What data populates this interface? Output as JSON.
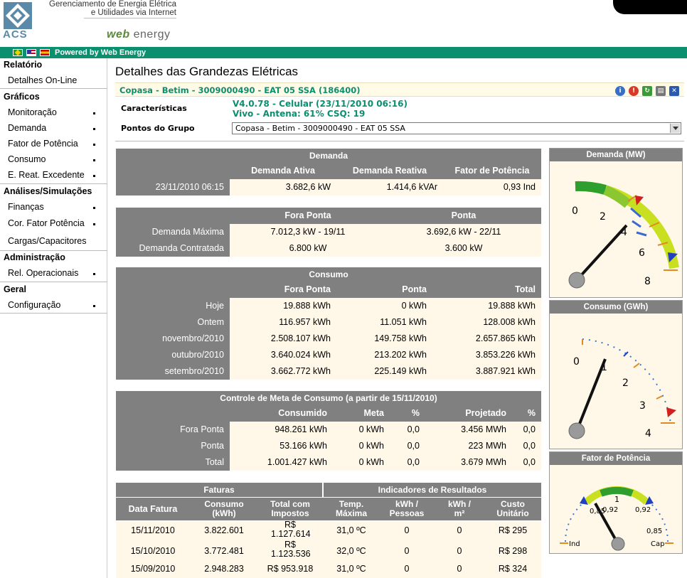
{
  "header": {
    "logo_text": "ACS",
    "company_line1": "Gerenciamento de Energia Elétrica",
    "company_line2": "e Utilidades via Internet",
    "brand_web": "web",
    "brand_energy": "energy",
    "powered_by": "Powered by Web Energy"
  },
  "sidebar": {
    "sections": [
      {
        "title": "Relatório",
        "items": [
          "Detalhes On-Line"
        ]
      },
      {
        "title": "Gráficos",
        "items": [
          "Monitoração",
          "Demanda",
          "Fator de Potência",
          "Consumo",
          "E. Reat. Excedente"
        ]
      },
      {
        "title": "Análises/Simulações",
        "items": [
          "Finanças",
          "Cor. Fator Potência",
          "Cargas/Capacitores"
        ]
      },
      {
        "title": "Administração",
        "items": [
          "Rel. Operacionais"
        ]
      },
      {
        "title": "Geral",
        "items": [
          "Configuração"
        ]
      }
    ]
  },
  "main": {
    "title": "Detalhes das Grandezas Elétricas",
    "subheader": "Copasa - Betim - 3009000490 - EAT 05 SSA (186400)",
    "caracteristicas_label": "Características",
    "caracteristicas_line1": "V4.0.78 - Celular (23/11/2010 06:16)",
    "caracteristicas_line2": "Vivo - Antena: 61% CSQ: 19",
    "pontos_label": "Pontos do Grupo",
    "pontos_value": "Copasa - Betim - 3009000490 - EAT 05 SSA"
  },
  "demanda": {
    "title": "Demanda",
    "cols": [
      "Demanda Ativa",
      "Demanda Reativa",
      "Fator de Potência"
    ],
    "row_label": "23/11/2010 06:15",
    "values": [
      "3.682,6 kW",
      "1.414,6 kVAr",
      "0,93 Ind"
    ]
  },
  "contrato": {
    "cols": [
      "Fora Ponta",
      "Ponta"
    ],
    "rows": [
      {
        "label": "Demanda Máxima",
        "values": [
          "7.012,3 kW - 19/11",
          "3.692,6 kW - 22/11"
        ]
      },
      {
        "label": "Demanda Contratada",
        "values": [
          "6.800 kW",
          "3.600 kW"
        ]
      }
    ]
  },
  "consumo": {
    "title": "Consumo",
    "cols": [
      "Fora Ponta",
      "Ponta",
      "Total"
    ],
    "rows": [
      {
        "label": "Hoje",
        "values": [
          "19.888 kWh",
          "0 kWh",
          "19.888 kWh"
        ]
      },
      {
        "label": "Ontem",
        "values": [
          "116.957 kWh",
          "11.051 kWh",
          "128.008 kWh"
        ]
      },
      {
        "label": "novembro/2010",
        "values": [
          "2.508.107 kWh",
          "149.758 kWh",
          "2.657.865 kWh"
        ]
      },
      {
        "label": "outubro/2010",
        "values": [
          "3.640.024 kWh",
          "213.202 kWh",
          "3.853.226 kWh"
        ]
      },
      {
        "label": "setembro/2010",
        "values": [
          "3.662.772 kWh",
          "225.149 kWh",
          "3.887.921 kWh"
        ]
      }
    ]
  },
  "meta": {
    "title": "Controle de Meta de Consumo (a partir de 15/11/2010)",
    "cols": [
      "Consumido",
      "Meta",
      "%",
      "Projetado",
      "%"
    ],
    "rows": [
      {
        "label": "Fora Ponta",
        "values": [
          "948.261 kWh",
          "0 kWh",
          "0,0",
          "3.456 MWh",
          "0,0"
        ]
      },
      {
        "label": "Ponta",
        "values": [
          "53.166 kWh",
          "0 kWh",
          "0,0",
          "223 MWh",
          "0,0"
        ]
      },
      {
        "label": "Total",
        "values": [
          "1.001.427 kWh",
          "0 kWh",
          "0,0",
          "3.679 MWh",
          "0,0"
        ]
      }
    ]
  },
  "faturas": {
    "title": "Faturas",
    "indicadores_title": "Indicadores de Resultados",
    "cols": [
      "Data Fatura",
      "Consumo (kWh)",
      "Total com Impostos",
      "Temp. Máxima",
      "kWh / Pessoas",
      "kWh / m²",
      "Custo Unitário"
    ],
    "rows": [
      [
        "15/11/2010",
        "3.822.601",
        "R$ 1.127.614",
        "31,0 ºC",
        "0",
        "0",
        "R$ 295"
      ],
      [
        "15/10/2010",
        "3.772.481",
        "R$ 1.123.536",
        "32,0 ºC",
        "0",
        "0",
        "R$ 298"
      ],
      [
        "15/09/2010",
        "2.948.283",
        "R$ 953.918",
        "31,0 ºC",
        "0",
        "0",
        "R$ 324"
      ]
    ]
  },
  "gauges": {
    "demanda": {
      "title": "Demanda (MW)",
      "ticks": [
        "0",
        "2",
        "4",
        "6",
        "8"
      ],
      "value": 3.68,
      "max": 8
    },
    "consumo": {
      "title": "Consumo (GWh)",
      "ticks": [
        "0",
        "1",
        "2",
        "3",
        "4"
      ],
      "value": 1.0,
      "max": 4
    },
    "fp": {
      "title": "Fator de Potência",
      "labels": [
        "0,85",
        "0,92",
        "1",
        "0,92",
        "0,85",
        "Ind",
        "Cap"
      ],
      "value": 0.93
    }
  },
  "colors": {
    "accent": "#0b8f6f",
    "header_gray": "#808080",
    "cell_bg": "#fff8e8"
  }
}
